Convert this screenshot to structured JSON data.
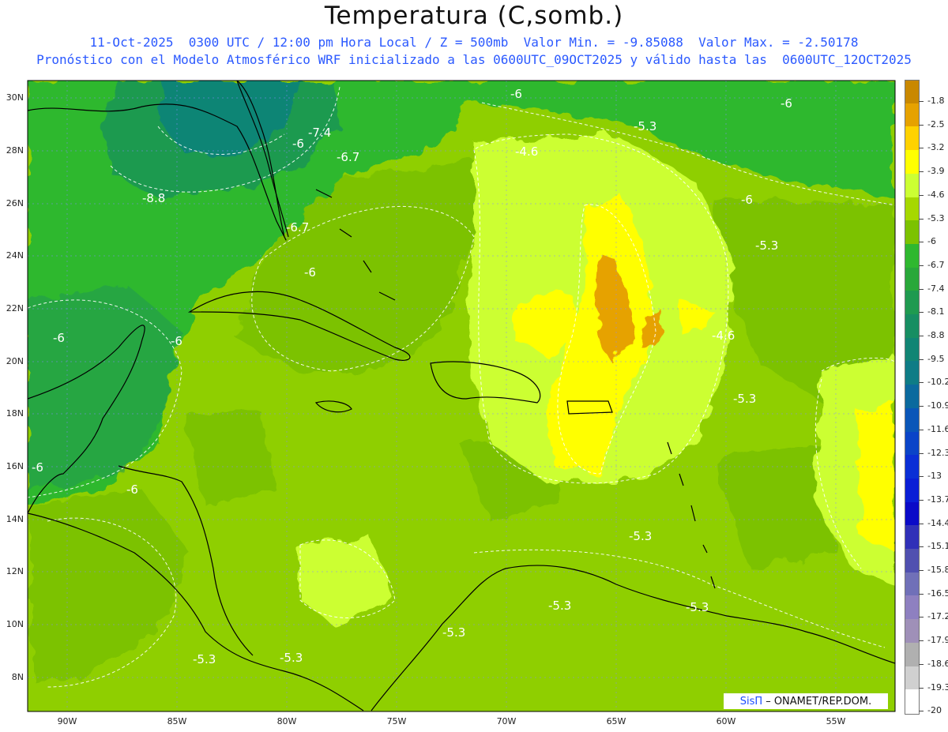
{
  "header": {
    "title": "Temperatura (C,somb.)",
    "line1": "11-Oct-2025  0300 UTC / 12:00 pm Hora Local / Z = 500mb  Valor Min. = -9.85088  Valor Max. = -2.50178",
    "line2": "Pronóstico con el Modelo Atmosférico WRF inicializado a las 0600UTC_09OCT2025 y válido hasta las  0600UTC_12OCT2025"
  },
  "axes": {
    "lat_labels": [
      "30N",
      "28N",
      "26N",
      "24N",
      "22N",
      "20N",
      "18N",
      "16N",
      "14N",
      "12N",
      "10N",
      "8N"
    ],
    "lon_labels": [
      "90W",
      "85W",
      "80W",
      "75W",
      "70W",
      "65W",
      "60W",
      "55W"
    ]
  },
  "colorbar": {
    "labels": [
      "-1.8",
      "-2.5",
      "-3.2",
      "-3.9",
      "-4.6",
      "-5.3",
      "-6",
      "-6.7",
      "-7.4",
      "-8.1",
      "-8.8",
      "-9.5",
      "-10.2",
      "-10.9",
      "-11.6",
      "-12.3",
      "-13",
      "-13.7",
      "-14.4",
      "-15.1",
      "-15.8",
      "-16.5",
      "-17.2",
      "-17.9",
      "-18.6",
      "-19.3",
      "-20"
    ],
    "colors": [
      "#c98800",
      "#e6a200",
      "#ffd200",
      "#ffff00",
      "#ccff33",
      "#a6d800",
      "#7cc200",
      "#2fb82f",
      "#29a83a",
      "#1f9a50",
      "#178e62",
      "#118574",
      "#0e7c86",
      "#0b6a9e",
      "#0a56b8",
      "#0a44c8",
      "#0a2fd6",
      "#0a1ed6",
      "#0a0ac8",
      "#3030b8",
      "#5050b0",
      "#7070b8",
      "#8e80c0",
      "#9f90b8",
      "#b0b0b0",
      "#d0d0d0",
      "#ffffff"
    ]
  },
  "contour_labels": [
    {
      "text": "-6"
    },
    {
      "text": "-6"
    },
    {
      "text": "-7.4"
    },
    {
      "text": "-6"
    },
    {
      "text": "-6.7"
    },
    {
      "text": "-4.6"
    },
    {
      "text": "-5.3"
    },
    {
      "text": "-8.8"
    },
    {
      "text": "-6"
    },
    {
      "text": "-6.7"
    },
    {
      "text": "-5.3"
    },
    {
      "text": "-6"
    },
    {
      "text": "-4.6"
    },
    {
      "text": "-6"
    },
    {
      "text": "-6"
    },
    {
      "text": "-5.3"
    },
    {
      "text": "-6"
    },
    {
      "text": "-6"
    },
    {
      "text": "-5.3"
    },
    {
      "text": "-5.3"
    },
    {
      "text": "-5.3"
    },
    {
      "text": "-5.3"
    },
    {
      "text": "-5.3"
    },
    {
      "text": "-5.3"
    }
  ],
  "credit": {
    "brand": "SisΠ",
    "text": "– ONAMET/REP.DOM."
  }
}
